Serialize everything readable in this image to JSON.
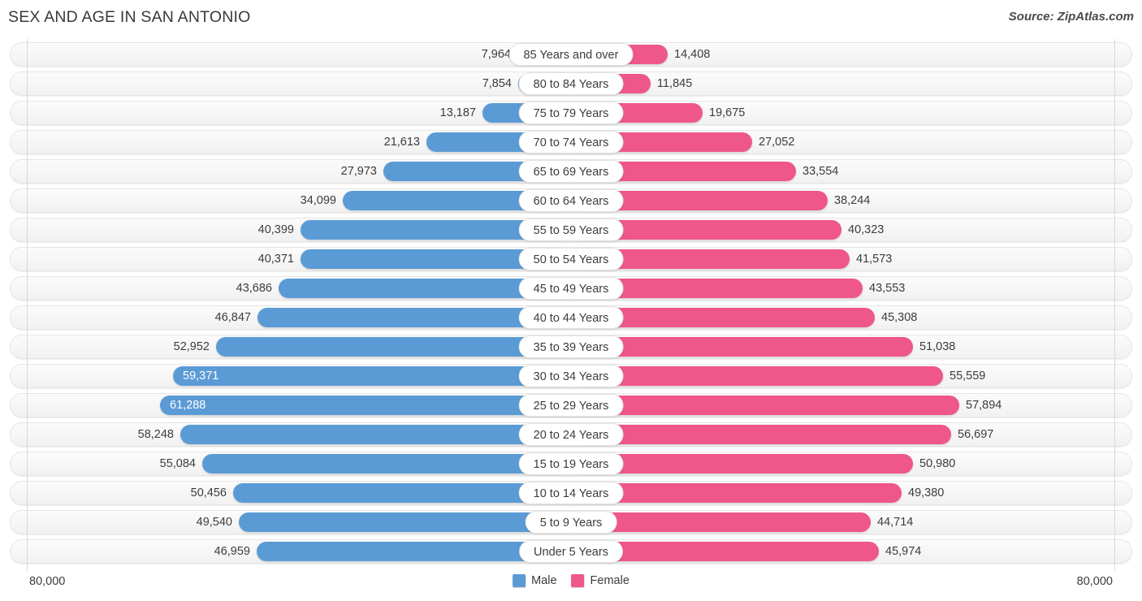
{
  "header": {
    "title": "SEX AND AGE IN SAN ANTONIO",
    "source": "Source: ZipAtlas.com"
  },
  "footer": {
    "axis_left": "80,000",
    "axis_right": "80,000",
    "legend": [
      {
        "label": "Male",
        "color": "#5b9bd5"
      },
      {
        "label": "Female",
        "color": "#ef5689"
      }
    ]
  },
  "chart_data": {
    "type": "bar",
    "subtype": "population-pyramid",
    "title": "SEX AND AGE IN SAN ANTONIO",
    "xlabel": "",
    "ylabel": "",
    "xlim": [
      0,
      80000
    ],
    "axis_max": 80000,
    "grid": false,
    "legend_position": "bottom-center",
    "categories": [
      "85 Years and over",
      "80 to 84 Years",
      "75 to 79 Years",
      "70 to 74 Years",
      "65 to 69 Years",
      "60 to 64 Years",
      "55 to 59 Years",
      "50 to 54 Years",
      "45 to 49 Years",
      "40 to 44 Years",
      "35 to 39 Years",
      "30 to 34 Years",
      "25 to 29 Years",
      "20 to 24 Years",
      "15 to 19 Years",
      "10 to 14 Years",
      "5 to 9 Years",
      "Under 5 Years"
    ],
    "series": [
      {
        "name": "Male",
        "color": "#5b9bd5",
        "side": "left",
        "values": [
          7964,
          7854,
          13187,
          21613,
          27973,
          34099,
          40399,
          40371,
          43686,
          46847,
          52952,
          59371,
          61288,
          58248,
          55084,
          50456,
          49540,
          46959
        ],
        "labels": [
          "7,964",
          "7,854",
          "13,187",
          "21,613",
          "27,973",
          "34,099",
          "40,399",
          "40,371",
          "43,686",
          "46,847",
          "52,952",
          "59,371",
          "61,288",
          "58,248",
          "55,084",
          "50,456",
          "49,540",
          "46,959"
        ]
      },
      {
        "name": "Female",
        "color": "#ef5689",
        "side": "right",
        "values": [
          14408,
          11845,
          19675,
          27052,
          33554,
          38244,
          40323,
          41573,
          43553,
          45308,
          51038,
          55559,
          57894,
          56697,
          50980,
          49380,
          44714,
          45974
        ],
        "labels": [
          "14,408",
          "11,845",
          "19,675",
          "27,052",
          "33,554",
          "38,244",
          "40,323",
          "41,573",
          "43,553",
          "45,308",
          "51,038",
          "55,559",
          "57,894",
          "56,697",
          "50,980",
          "49,380",
          "44,714",
          "45,974"
        ]
      }
    ]
  }
}
